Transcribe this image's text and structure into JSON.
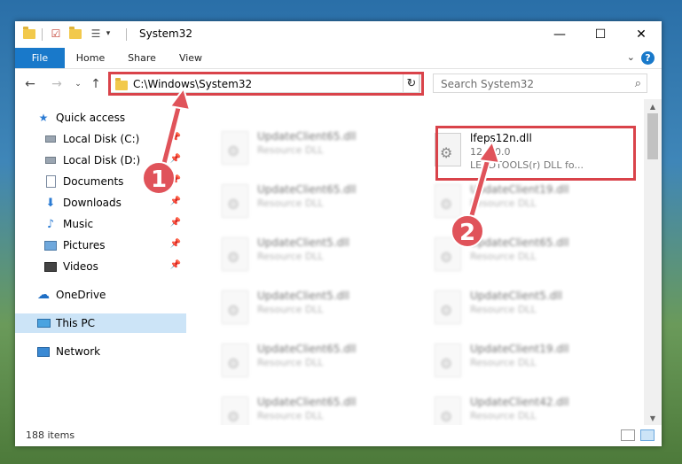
{
  "title": "System32",
  "ribbon": {
    "tabs": [
      "File",
      "Home",
      "Share",
      "View"
    ]
  },
  "address": {
    "path": "C:\\Windows\\System32"
  },
  "search": {
    "placeholder": "Search System32"
  },
  "nav": {
    "quick_access": "Quick access",
    "items": [
      {
        "label": "Local Disk (C:)",
        "icon": "drive-icon"
      },
      {
        "label": "Local Disk (D:)",
        "icon": "drive-icon"
      },
      {
        "label": "Documents",
        "icon": "documents-icon"
      },
      {
        "label": "Downloads",
        "icon": "downloads-icon"
      },
      {
        "label": "Music",
        "icon": "music-icon"
      },
      {
        "label": "Pictures",
        "icon": "pictures-icon"
      },
      {
        "label": "Videos",
        "icon": "videos-icon"
      }
    ],
    "onedrive": "OneDrive",
    "this_pc": "This PC",
    "network": "Network"
  },
  "files": {
    "left": [
      {
        "name": "UpdateClient65.dll",
        "type": "Resource DLL"
      },
      {
        "name": "UpdateClient65.dll",
        "type": "Resource DLL"
      },
      {
        "name": "UpdateClient5.dll",
        "type": "Resource DLL"
      },
      {
        "name": "UpdateClient5.dll",
        "type": "Resource DLL"
      },
      {
        "name": "UpdateClient65.dll",
        "type": "Resource DLL"
      },
      {
        "name": "UpdateClient65.dll",
        "type": "Resource DLL"
      }
    ],
    "right": [
      {
        "name": "lfeps12n.dll",
        "version": "12.1.0.0",
        "description": "LEADTOOLS(r) DLL fo..."
      },
      {
        "name": "UpdateClient19.dll",
        "type": "Resource DLL"
      },
      {
        "name": "UpdateClient65.dll",
        "type": "Resource DLL"
      },
      {
        "name": "UpdateClient5.dll",
        "type": "Resource DLL"
      },
      {
        "name": "UpdateClient19.dll",
        "type": "Resource DLL"
      },
      {
        "name": "UpdateClient42.dll",
        "type": "Resource DLL"
      }
    ]
  },
  "status": {
    "count": "188 items"
  },
  "callouts": [
    "1",
    "2"
  ],
  "colors": {
    "accent": "#1979ca",
    "highlight": "#d9434a",
    "selected": "#cce4f7"
  }
}
